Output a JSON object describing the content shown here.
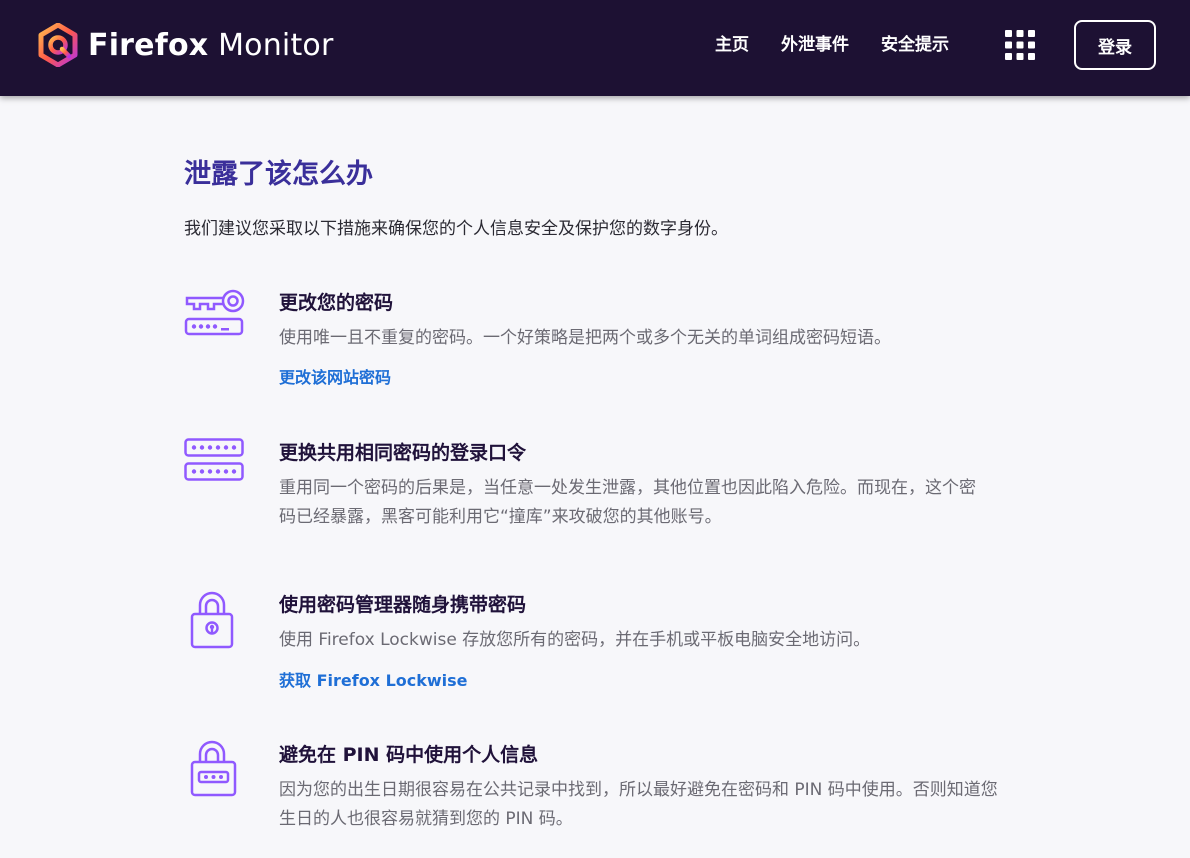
{
  "header": {
    "brand_bold": "Firefox",
    "brand_light": " Monitor",
    "nav": [
      {
        "label": "主页"
      },
      {
        "label": "外泄事件"
      },
      {
        "label": "安全提示"
      }
    ],
    "apps_icon": "grid-icon",
    "login_label": "登录",
    "background": "#1d1133"
  },
  "main": {
    "title": "泄露了该怎么办",
    "intro": "我们建议您采取以下措施来确保您的个人信息安全及保护您的数字身份。",
    "items": [
      {
        "icon": "key-password-icon",
        "title": "更改您的密码",
        "description": "使用唯一且不重复的密码。一个好策略是把两个或多个无关的单词组成密码短语。",
        "link": "更改该网站密码"
      },
      {
        "icon": "password-fields-icon",
        "title": "更换共用相同密码的登录口令",
        "description": "重用同一个密码的后果是，当任意一处发生泄露，其他位置也因此陷入危险。而现在，这个密码已经暴露，黑客可能利用它“撞库”来攻破您的其他账号。"
      },
      {
        "icon": "padlock-keyhole-icon",
        "title": "使用密码管理器随身携带密码",
        "description": "使用 Firefox Lockwise 存放您所有的密码，并在手机或平板电脑安全地访问。",
        "link": "获取 Firefox Lockwise"
      },
      {
        "icon": "padlock-pin-icon",
        "title": "避免在 PIN 码中使用个人信息",
        "description": "因为您的出生日期很容易在公共记录中找到，所以最好避免在密码和 PIN 码中使用。否则知道您生日的人也很容易就猜到您的 PIN 码。"
      }
    ]
  },
  "colors": {
    "title": "#3a2f9a",
    "link": "#1f6fd6",
    "icon_purple": "#9059ff"
  }
}
